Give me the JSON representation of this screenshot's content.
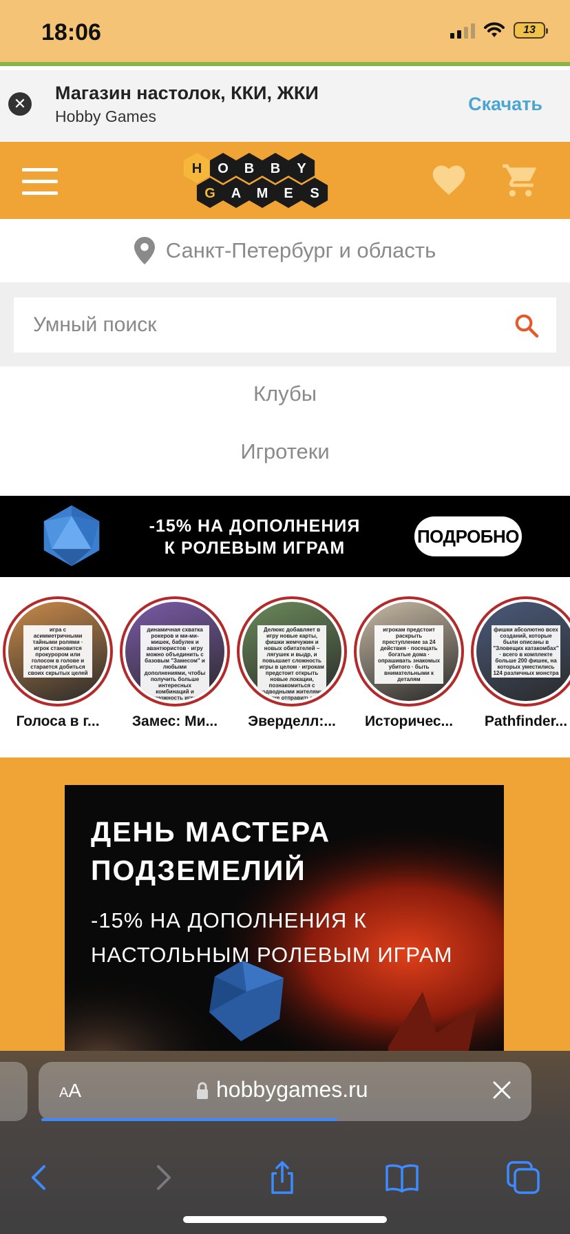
{
  "status": {
    "time": "18:06",
    "battery": "13"
  },
  "smart_banner": {
    "title": "Магазин настолок, ККИ, ЖКИ",
    "subtitle": "Hobby Games",
    "action": "Скачать",
    "close_glyph": "✕"
  },
  "header": {
    "logo_letters_top": [
      "H",
      "O",
      "B",
      "B",
      "Y"
    ],
    "logo_letters_bottom": [
      "G",
      "A",
      "M",
      "E",
      "S"
    ],
    "icons": [
      "menu-icon",
      "heart-icon",
      "cart-icon"
    ],
    "accent_color": "#f0a436"
  },
  "location": {
    "text": "Санкт-Петербург и область",
    "icon": "location-pin-icon"
  },
  "search": {
    "placeholder": "Умный поиск",
    "icon": "search-icon",
    "icon_color": "#e8572a"
  },
  "nav_links": [
    "Клубы",
    "Игротеки"
  ],
  "promo": {
    "line1": "-15% НА ДОПОЛНЕНИЯ",
    "line2": "К РОЛЕВЫМ ИГРАМ",
    "button": "ПОДРОБНО"
  },
  "stories": [
    {
      "label": "Голоса в г...",
      "caption": "игра с асимметричными тайными ролями · игрок становится прокурором или голосом в голове и старается добиться своих скрытых целей",
      "color": "#c98a4a"
    },
    {
      "label": "Замес: Ми...",
      "caption": "динамичная схватка рокеров и ми-ми-мишек, бабулек и авантюристов · игру можно объединить с базовым \"Замесом\" и любыми дополнениями, чтобы получить больше интересных комбинаций и возможность играть большой компанией",
      "color": "#7b5aa8"
    },
    {
      "label": "Эверделл:...",
      "caption": "Делюкс добавляет в игру новые карты, фишки жемчужин и новых обитателей – лягушек и выдр, и повышает сложность игры в целом · игрокам предстоит открыть новые локации, познакомиться с подводными жителями, а также отправиться на охоту за новым видом ресурсов – жемчужинами",
      "color": "#6a8a5a"
    },
    {
      "label": "Историчес...",
      "caption": "игрокам предстоит раскрыть преступление за 24 действия · посещать богатые дома · опрашивать знакомых убитого · быть внимательными к деталям",
      "color": "#c7b9a4"
    },
    {
      "label": "Pathfinder...",
      "caption": "фишки абсолютно всех созданий, которые были описаны в \"Зловещих катакомбах\" · всего в комплекте больше 200 фишек, на которых уместились 124 различных монстра",
      "color": "#4a5a7a"
    }
  ],
  "big_banner": {
    "title_line1": "ДЕНЬ МАСТЕРА",
    "title_line2": "ПОДЗЕМЕЛИЙ",
    "sub_line1": "-15% НА ДОПОЛНЕНИЯ К",
    "sub_line2": "НАСТОЛЬНЫМ РОЛЕВЫМ ИГРАМ"
  },
  "browser": {
    "text_size_label_small": "A",
    "text_size_label_large": "A",
    "url": "hobbygames.ru",
    "load_progress": 0.6,
    "toolbar": [
      "back-icon",
      "forward-icon",
      "share-icon",
      "bookmarks-icon",
      "tabs-icon"
    ]
  }
}
